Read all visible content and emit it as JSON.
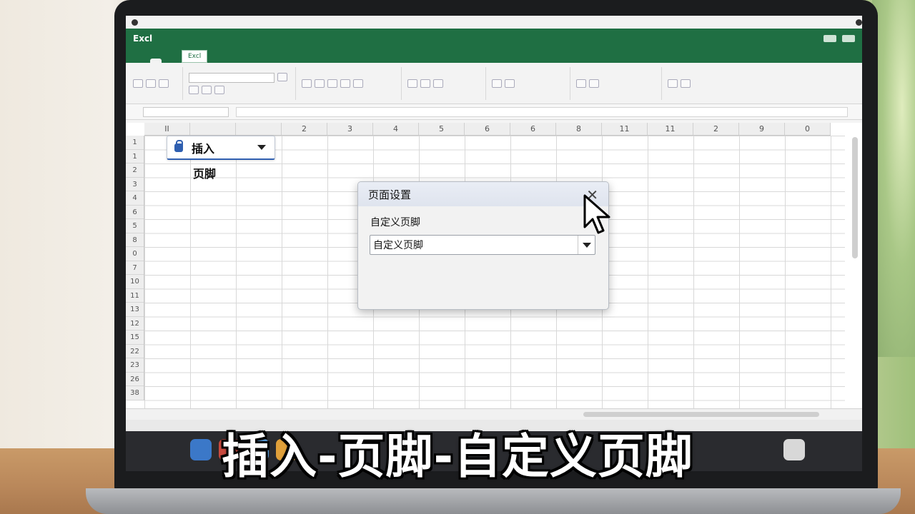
{
  "excel": {
    "logo": "Excl",
    "tabs": [
      "Excl"
    ]
  },
  "grid": {
    "column_headers": [
      "II",
      "",
      "",
      "2",
      "3",
      "4",
      "5",
      "6",
      "6",
      "8",
      "11",
      "11",
      "2",
      "9",
      "0"
    ],
    "row_headers": [
      "1",
      "1",
      "2",
      "3",
      "4",
      "6",
      "5",
      "8",
      "0",
      "7",
      "10",
      "11",
      "13",
      "12",
      "15",
      "22",
      "23",
      "26",
      "38"
    ]
  },
  "insert_menu": {
    "label": "插入",
    "option": "页脚"
  },
  "dialog": {
    "title": "页面设置",
    "close_icon": "close-icon",
    "section_label": "自定义页脚",
    "select_value": "自定义页脚"
  },
  "caption": {
    "text": "插入-页脚-自定义页脚"
  },
  "colors": {
    "excel_green": "#1f6f43",
    "accent_blue": "#2f5fb0"
  }
}
